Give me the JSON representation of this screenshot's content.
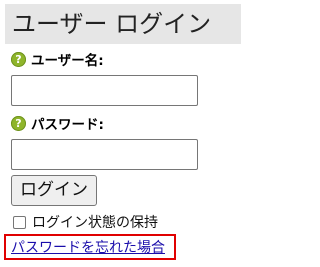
{
  "login": {
    "title": "ユーザー ログイン",
    "username_label": "ユーザー名:",
    "username_value": "",
    "password_label": "パスワード:",
    "password_value": "",
    "login_button": "ログイン",
    "remember_label": "ログイン状態の保持",
    "remember_checked": false,
    "forgot_link": "パスワードを忘れた場合"
  },
  "icons": {
    "help": "help-icon",
    "help_glyph": "?"
  },
  "colors": {
    "title_bar_bg": "#e6e6e6",
    "help_icon": "#8fb52b",
    "link": "#1a0dab",
    "highlight_border": "#e00000"
  }
}
